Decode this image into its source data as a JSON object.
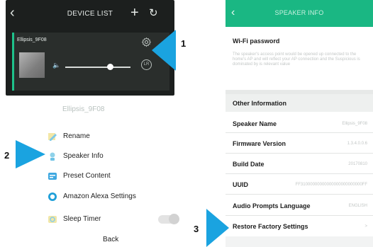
{
  "device_list": {
    "title": "DEVICE LIST",
    "back_icon": "chevron-left-icon",
    "add_icon": "plus-icon",
    "refresh_icon": "refresh-icon",
    "device": {
      "name": "Ellipsis_9F08",
      "settings_icon": "gear-icon",
      "volume_icon": "speaker-volume-icon",
      "volume_level_fraction": 0.64,
      "channel_badge": "LR",
      "accent_color": "#1ec28b"
    }
  },
  "callouts": {
    "one": "1",
    "two": "2",
    "three": "3",
    "arrow_color": "#1aa3e0"
  },
  "speaker_menu": {
    "title": "Ellipsis_9F08",
    "items": [
      {
        "label": "Rename",
        "icon": "rename-icon"
      },
      {
        "label": "Speaker Info",
        "icon": "info-icon"
      },
      {
        "label": "Preset Content",
        "icon": "preset-icon"
      },
      {
        "label": "Amazon Alexa Settings",
        "icon": "alexa-icon"
      },
      {
        "label": "Sleep Timer",
        "icon": "sleep-timer-icon"
      }
    ],
    "back_label": "Back"
  },
  "speaker_info": {
    "title": "SPEAKER INFO",
    "header_color": "#1ab783",
    "wifi_password_label": "Wi-Fi password",
    "wifi_password_text": "The speaker's access point would be opened up connected to the home's AP and will reflect your AP connection and the Suspicious is dominated by is relevant value",
    "other_info_header": "Other Information",
    "rows": [
      {
        "label": "Speaker Name",
        "value": "Ellipsis_9F08"
      },
      {
        "label": "Firmware Version",
        "value": "1.3.4.0.0.6"
      },
      {
        "label": "Build Date",
        "value": "20170810"
      },
      {
        "label": "UUID",
        "value": "FF31000000000000000000000000FF"
      },
      {
        "label": "Audio Prompts Language",
        "value": "ENGLISH"
      },
      {
        "label": "Restore Factory Settings",
        "value": ">"
      }
    ]
  }
}
